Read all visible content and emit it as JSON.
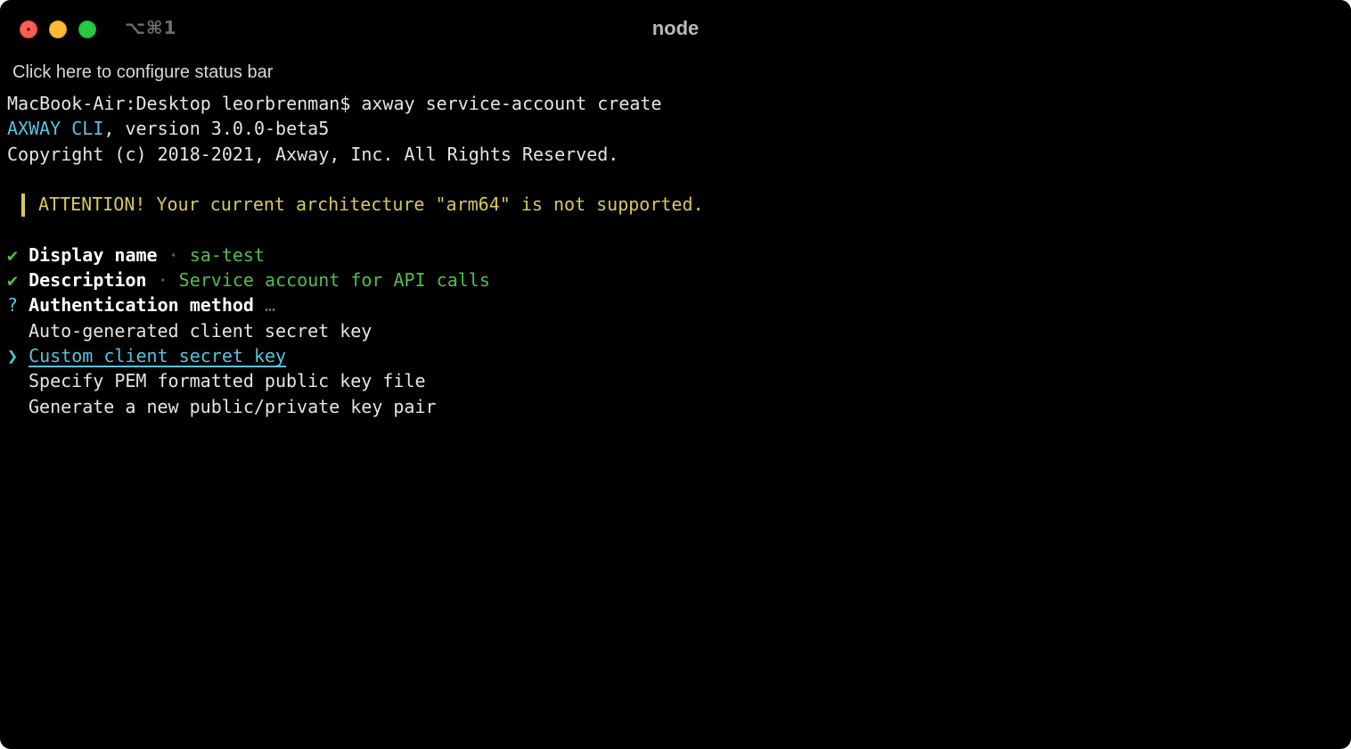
{
  "window": {
    "title": "node",
    "shortcut": "⌥⌘1",
    "status_bar_hint": "Click here to configure status bar"
  },
  "terminal": {
    "prompt_line": "MacBook-Air:Desktop leorbrenman$ axway service-account create",
    "version": {
      "product": "AXWAY CLI",
      "rest": ", version 3.0.0-beta5"
    },
    "copyright": "Copyright (c) 2018-2021, Axway, Inc. All Rights Reserved.",
    "attention": "ATTENTION! Your current architecture \"arm64\" is not supported.",
    "answers": [
      {
        "mark": "✔",
        "label": "Display name",
        "sep": " · ",
        "value": "sa-test"
      },
      {
        "mark": "✔",
        "label": "Description",
        "sep": " · ",
        "value": "Service account for API calls"
      }
    ],
    "question": {
      "mark": "?",
      "label": "Authentication method",
      "sep": " …"
    },
    "pointer": "❯",
    "options": [
      "Auto-generated client secret key",
      "Custom client secret key",
      "Specify PEM formatted public key file",
      "Generate a new public/private key pair"
    ]
  },
  "colors": {
    "background": "#000000",
    "accent_cyan": "#59c2e0",
    "warning_yellow": "#d8c95a",
    "success_green": "#4fbf4a"
  }
}
